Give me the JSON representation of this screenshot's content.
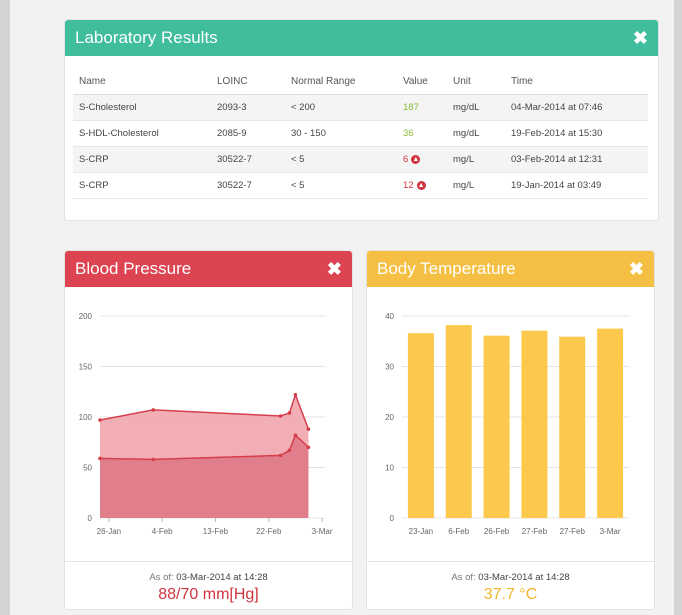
{
  "lab": {
    "title": "Laboratory Results",
    "close_icon": "✖",
    "columns": [
      "Name",
      "LOINC",
      "Normal Range",
      "Value",
      "Unit",
      "Time"
    ],
    "rows": [
      {
        "name": "S-Cholesterol",
        "loinc": "2093-3",
        "range": "< 200",
        "value": "187",
        "flag": "normal",
        "unit": "mg/dL",
        "time": "04-Mar-2014 at 07:46"
      },
      {
        "name": "S-HDL-Cholesterol",
        "loinc": "2085-9",
        "range": "30 - 150",
        "value": "36",
        "flag": "normal",
        "unit": "mg/dL",
        "time": "19-Feb-2014 at 15:30"
      },
      {
        "name": "S-CRP",
        "loinc": "30522-7",
        "range": "< 5",
        "value": "6",
        "flag": "high",
        "unit": "mg/L",
        "time": "03-Feb-2014 at 12:31"
      },
      {
        "name": "S-CRP",
        "loinc": "30522-7",
        "range": "< 5",
        "value": "12",
        "flag": "high",
        "unit": "mg/L",
        "time": "19-Jan-2014 at 03:49"
      }
    ],
    "colors": {
      "header": "#3fbd9c",
      "normal": "#8bbf3a",
      "high": "#d0343f"
    }
  },
  "bp": {
    "title": "Blood Pressure",
    "close_icon": "✖",
    "asof_label": "As of:",
    "asof_value": "03-Mar-2014 at 14:28",
    "reading": "88/70 mm[Hg]",
    "colors": {
      "header": "#dc4452",
      "upper": "#f0a5ad",
      "lower": "#de7986",
      "line": "#d63e4c"
    }
  },
  "bt": {
    "title": "Body Temperature",
    "close_icon": "✖",
    "asof_label": "As of:",
    "asof_value": "03-Mar-2014 at 14:28",
    "reading": "37.7 °C",
    "colors": {
      "header": "#f5bf44",
      "bar": "#fcc94c"
    }
  },
  "chart_data": [
    {
      "type": "area",
      "ylim": [
        0,
        200
      ],
      "yticks": [
        0,
        50,
        100,
        150,
        200
      ],
      "xticks": [
        "26-Jan",
        "4-Feb",
        "13-Feb",
        "22-Feb",
        "3-Mar"
      ],
      "xrange": [
        -1.5,
        36.5
      ],
      "series": [
        {
          "x": [
            -1.5,
            7.5,
            29,
            30.5,
            31.5,
            33.7
          ],
          "values": [
            97,
            107,
            101,
            104,
            122,
            88
          ]
        },
        {
          "x": [
            -1.5,
            7.5,
            29,
            30.5,
            31.5,
            33.7
          ],
          "values": [
            59,
            58,
            62,
            67,
            82,
            70
          ]
        }
      ]
    },
    {
      "type": "bar",
      "ylim": [
        0,
        40
      ],
      "yticks": [
        0,
        10,
        20,
        30,
        40
      ],
      "categories": [
        "23-Jan",
        "6-Feb",
        "26-Feb",
        "27-Feb",
        "27-Feb",
        "3-Mar"
      ],
      "values": [
        36.6,
        38.2,
        36.1,
        37.1,
        35.9,
        37.5
      ]
    }
  ]
}
